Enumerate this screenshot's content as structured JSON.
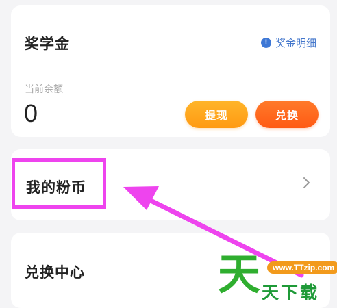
{
  "scholarship": {
    "title": "奖学金",
    "detail_link": "奖金明细",
    "info_icon": "info-icon",
    "balance_label": "当前余额",
    "balance_value": "0",
    "withdraw_button": "提现",
    "redeem_button": "兑换"
  },
  "coins": {
    "title": "我的粉币",
    "chevron_icon": "chevron-right-icon"
  },
  "exchange_center": {
    "title": "兑换中心"
  },
  "annotation": {
    "highlight_color": "#ee44ee",
    "arrow_color": "#ee44ee"
  },
  "watermark": {
    "big_char": "天",
    "url": "www.TTzip.com",
    "name": "天下载"
  },
  "colors": {
    "withdraw_button": "#ffa41c",
    "redeem_button": "#ff6a1e",
    "detail_link": "#4477cc",
    "background": "#f4f4f6"
  }
}
